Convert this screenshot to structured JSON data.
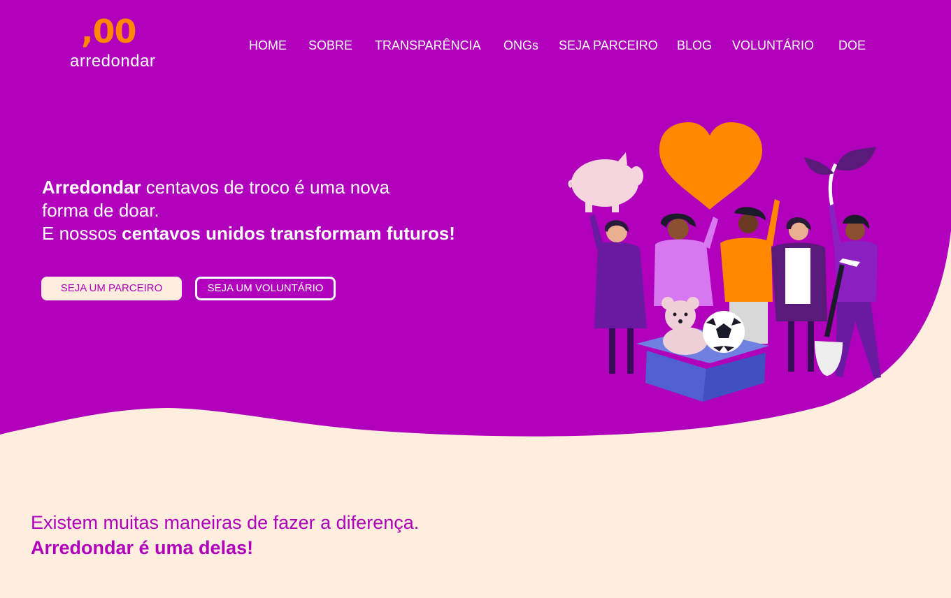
{
  "brand": {
    "logo_mark": ",00",
    "logo_word": "arredondar",
    "primary_color": "#b000bb",
    "accent_color": "#ff8800",
    "cream_color": "#ffeedd"
  },
  "nav": {
    "items": [
      {
        "label": "HOME"
      },
      {
        "label": "SOBRE"
      },
      {
        "label": "TRANSPARÊNCIA"
      },
      {
        "label": "ONGs"
      },
      {
        "label": "SEJA PARCEIRO"
      },
      {
        "label": "BLOG"
      },
      {
        "label": "VOLUNTÁRIO"
      },
      {
        "label": "DOE"
      }
    ]
  },
  "hero": {
    "line1_bold": "Arredondar",
    "line1_rest": " centavos de troco é uma nova",
    "line2": "forma de doar.",
    "line3_start": "E nossos ",
    "line3_bold": "centavos unidos transformam futuros!",
    "buttons": {
      "partner": "SEJA UM PARCEIRO",
      "volunteer": "SEJA UM VOLUNTÁRIO"
    },
    "illustration_icon": "people-donating-illustration"
  },
  "tagline": {
    "line1": "Existem muitas maneiras de fazer a diferença.",
    "line2": "Arredondar é uma delas!"
  }
}
